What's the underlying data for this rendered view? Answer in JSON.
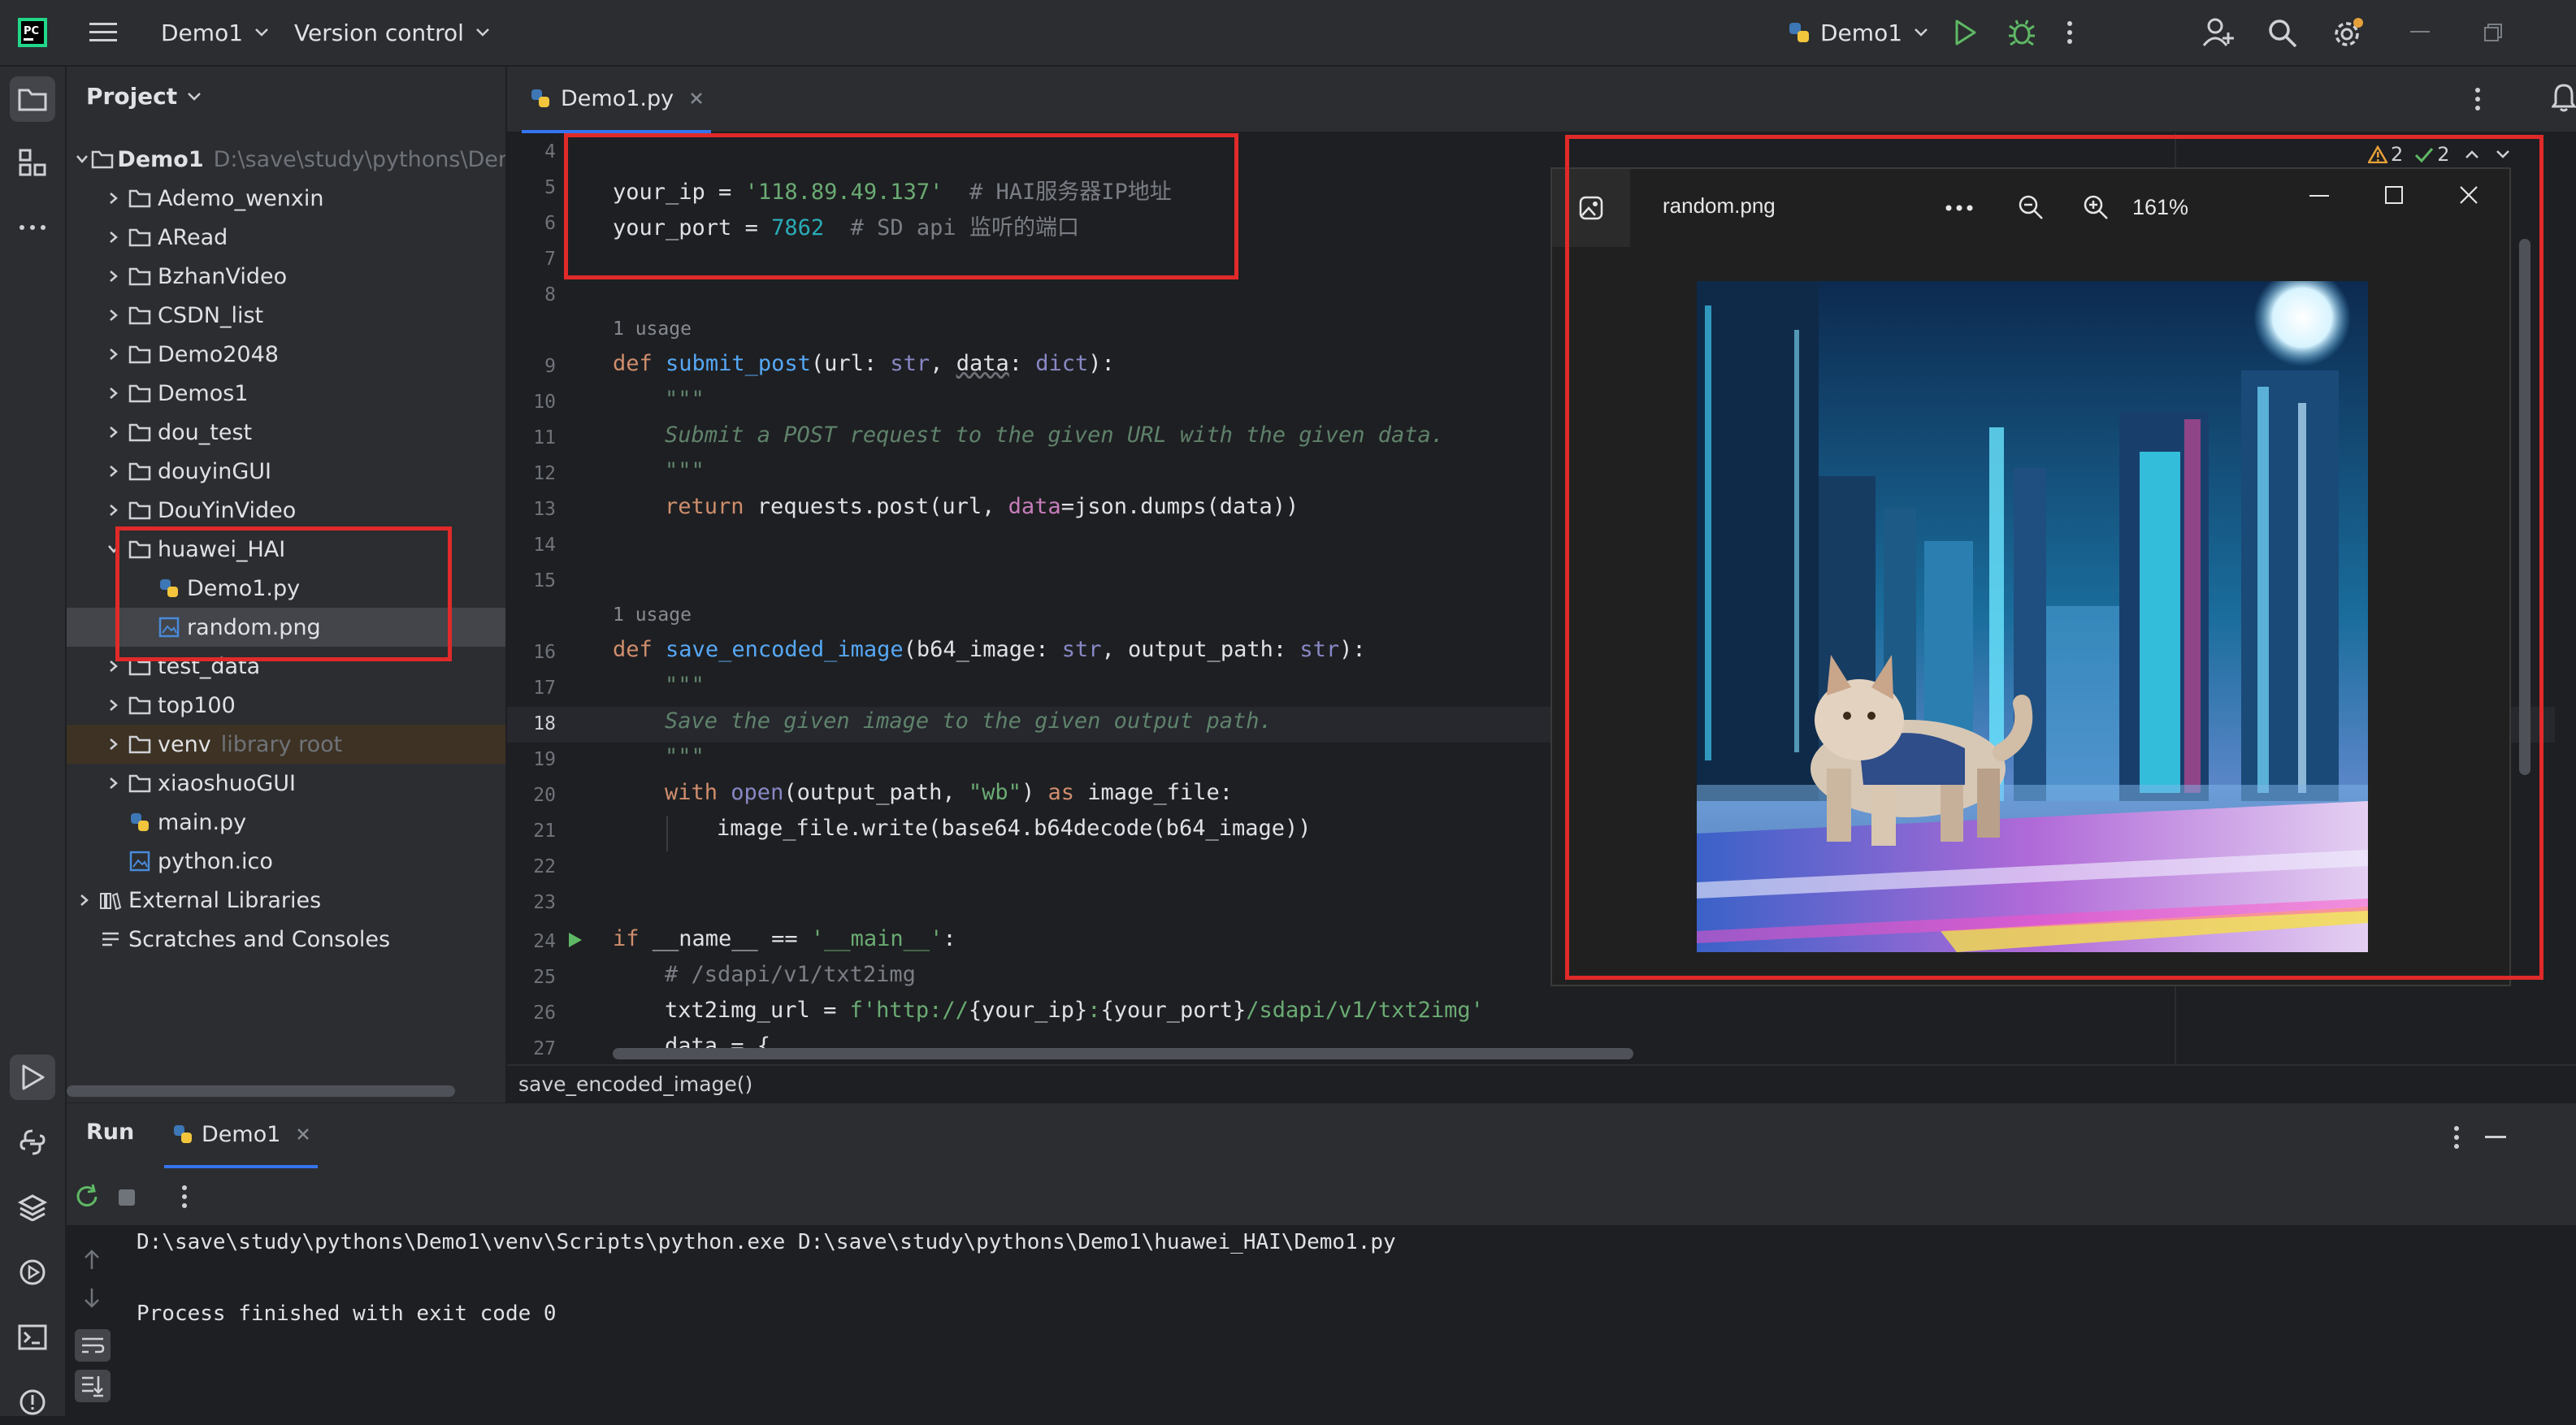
{
  "topbar": {
    "project_name": "Demo1",
    "vcs_label": "Version control",
    "run_config": "Demo1"
  },
  "project_panel": {
    "title": "Project",
    "root": {
      "name": "Demo1",
      "path": "D:\\save\\study\\pythons\\Den"
    },
    "folders": [
      "Ademo_wenxin",
      "ARead",
      "BzhanVideo",
      "CSDN_list",
      "Demo2048",
      "Demos1",
      "dou_test",
      "douyinGUI",
      "DouYinVideo"
    ],
    "open_folder": "huawei_HAI",
    "open_folder_children": [
      "Demo1.py",
      "random.png"
    ],
    "folders_after": [
      "test_data",
      "top100"
    ],
    "venv": {
      "name": "venv",
      "note": "library root"
    },
    "more_folders": [
      "xiaoshuoGUI"
    ],
    "files": [
      "main.py",
      "python.ico"
    ],
    "external": "External Libraries",
    "scratches": "Scratches and Consoles"
  },
  "editor": {
    "tab_label": "Demo1.py",
    "breadcrumb": "save_encoded_image()",
    "inspections": {
      "warnings": "2",
      "ok": "2"
    },
    "usage_hint": "1 usage",
    "line_numbers": [
      "4",
      "5",
      "6",
      "7",
      "8",
      "9",
      "10",
      "11",
      "12",
      "13",
      "14",
      "15",
      "16",
      "17",
      "18",
      "19",
      "20",
      "21",
      "22",
      "23",
      "24",
      "25",
      "26",
      "27"
    ],
    "code": {
      "l5_var": "your_ip",
      "l5_val": "'118.89.49.137'",
      "l5_cmt": "# HAI服务器IP地址",
      "l6_var": "your_port",
      "l6_val": "7862",
      "l6_cmt": "# SD api 监听的端口",
      "l9_def": "def",
      "l9_name": "submit_post",
      "l9_sig_a": "(url: ",
      "l9_str": "str",
      "l9_sig_b": ", ",
      "l9_data": "data",
      "l9_sig_c": ": ",
      "l9_dict": "dict",
      "l9_sig_d": "):",
      "docq": "\"\"\"",
      "l11_doc": "Submit a POST request to the given URL with the given data.",
      "l13_ret": "return",
      "l13_a": " requests.post(url, ",
      "l13_kw": "data",
      "l13_b": "=json.dumps(data))",
      "l16_def": "def",
      "l16_name": "save_encoded_image",
      "l16_a": "(b64_image: ",
      "l16_str1": "str",
      "l16_b": ", output_path: ",
      "l16_str2": "str",
      "l16_c": "):",
      "l18_doc": "Save the given image to the given output path.",
      "l20_with": "with",
      "l20_open": "open",
      "l20_a": "(output_path, ",
      "l20_wb": "\"wb\"",
      "l20_b": ") ",
      "l20_as": "as",
      "l20_c": " image_file:",
      "l21": "image_file.write(base64.b64decode(b64_image))",
      "l24_if": "if",
      "l24_a": " __name__ == ",
      "l24_main": "'__main__'",
      "l24_b": ":",
      "l25_cmt": "# /sdapi/v1/txt2img",
      "l26_a": "txt2img_url = ",
      "l26_f": "f'http://",
      "l26_ip": "{your_ip}",
      "l26_colon": ":",
      "l26_port": "{your_port}",
      "l26_path": "/sdapi/v1/txt2img'",
      "l27": "data = {"
    }
  },
  "image_viewer": {
    "filename": "random.png",
    "zoom": "161%"
  },
  "run_panel": {
    "title": "Run",
    "tab": "Demo1",
    "command": "D:\\save\\study\\pythons\\Demo1\\venv\\Scripts\\python.exe D:\\save\\study\\pythons\\Demo1\\huawei_HAI\\Demo1.py",
    "exit_message": "Process finished with exit code 0"
  },
  "colors": {
    "accent": "#3574f0",
    "highlight_box": "#e02a2a",
    "run_green": "#5fb865"
  }
}
